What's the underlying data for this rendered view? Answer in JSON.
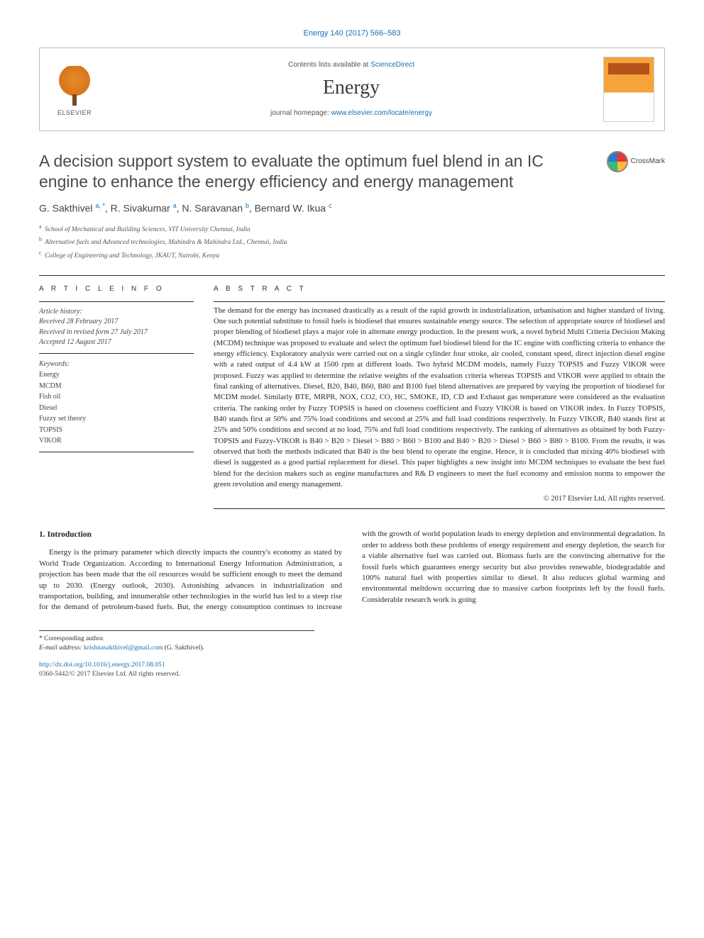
{
  "top_citation": "Energy 140 (2017) 566–583",
  "header": {
    "contents_prefix": "Contents lists available at ",
    "contents_link": "ScienceDirect",
    "journal": "Energy",
    "homepage_prefix": "journal homepage: ",
    "homepage_url": "www.elsevier.com/locate/energy",
    "publisher_word": "ELSEVIER"
  },
  "crossmark_label": "CrossMark",
  "title": "A decision support system to evaluate the optimum fuel blend in an IC engine to enhance the energy efficiency and energy management",
  "authors_html": "G. Sakthivel <sup>a, *</sup>, R. Sivakumar <sup>a</sup>, N. Saravanan <sup>b</sup>, Bernard W. Ikua <sup>c</sup>",
  "affiliations": [
    {
      "sup": "a",
      "text": "School of Mechanical and Building Sciences, VIT University Chennai, India"
    },
    {
      "sup": "b",
      "text": "Alternative fuels and Advanced technologies, Mahindra & Mahindra Ltd., Chennai, India"
    },
    {
      "sup": "c",
      "text": "College of Engineering and Technology, JKAUT, Nairobi, Kenya"
    }
  ],
  "article_info": {
    "heading": "A R T I C L E   I N F O",
    "history_label": "Article history:",
    "received": "Received 28 February 2017",
    "revised": "Received in revised form 27 July 2017",
    "accepted": "Accepted 12 August 2017",
    "keywords_label": "Keywords:",
    "keywords": [
      "Energy",
      "MCDM",
      "Fish oil",
      "Diesel",
      "Fuzzy set theory",
      "TOPSIS",
      "VIKOR"
    ]
  },
  "abstract": {
    "heading": "A B S T R A C T",
    "body": "The demand for the energy has increased drastically as a result of the rapid growth in industrialization, urbanisation and higher standard of living. One such potential substitute to fossil fuels is biodiesel that ensures sustainable energy source. The selection of appropriate source of biodiesel and proper blending of biodiesel plays a major role in alternate energy production. In the present work, a novel hybrid Multi Criteria Decision Making (MCDM) technique was proposed to evaluate and select the optimum fuel biodiesel blend for the IC engine with conflicting criteria to enhance the energy efficiency. Exploratory analysis were carried out on a single cylinder four stroke, air cooled, constant speed, direct injection diesel engine with a rated output of 4.4 kW at 1500 rpm at different loads. Two hybrid MCDM models, namely Fuzzy TOPSIS and Fuzzy VIKOR were proposed. Fuzzy was applied to determine the relative weights of the evaluation criteria whereas TOPSIS and VIKOR were applied to obtain the final ranking of alternatives. Diesel, B20, B40, B60, B80 and B100 fuel blend alternatives are prepared by varying the proportion of biodiesel for MCDM model. Similarly BTE, MRPR, NOX, CO2, CO, HC, SMOKE, ID, CD and Exhaust gas temperature were considered as the evaluation criteria. The ranking order by Fuzzy TOPSIS is based on closeness coefficient and Fuzzy VIKOR is based on VIKOR index. In Fuzzy TOPSIS, B40 stands first at 50% and 75% load conditions and second at 25% and full load conditions respectively. In Fuzzy VIKOR, B40 stands first at 25% and 50% conditions and second at no load, 75% and full load conditions respectively. The ranking of alternatives as obtained by both Fuzzy-TOPSIS and Fuzzy-VIKOR is B40 > B20 > Diesel > B80 > B60 > B100 and B40 > B20 > Diesel > B60 > B80 > B100. From the results, it was observed that both the methods indicated that B40 is the best blend to operate the engine. Hence, it is concluded that mixing 40% biodiesel with diesel is suggested as a good partial replacement for diesel. This paper highlights a new insight into MCDM techniques to evaluate the best fuel blend for the decision makers such as engine manufactures and R& D engineers to meet the fuel economy and emission norms to empower the green revolution and energy management.",
    "copyright": "© 2017 Elsevier Ltd. All rights reserved."
  },
  "intro": {
    "heading": "1. Introduction",
    "para": "Energy is the primary parameter which directly impacts the country's economy as stated by World Trade Organization. According to International Energy Information Administration, a projection has been made that the oil resources would be sufficient enough to meet the demand up to 2030. (Energy outlook, 2030). Astonishing advances in industrialization and transportation, building, and innumerable other technologies in the world has led to a steep rise for the demand of petroleum-based fuels. But, the energy consumption continues to increase with the growth of world population leads to energy depletion and environmental degradation. In order to address both these problems of energy requirement and energy depletion, the search for a viable alternative fuel was carried out. Biomass fuels are the convincing alternative for the fossil fuels which guarantees energy security but also provides renewable, biodegradable and 100% natural fuel with properties similar to diesel. It also reduces global warming and environmental meltdown occurring due to massive carbon footprints left by the fossil fuels. Considerable research work is going"
  },
  "footer": {
    "corresponding": "* Corresponding author.",
    "email_label": "E-mail address: ",
    "email": "krishnasakthivel@gmail.com",
    "email_person": " (G. Sakthivel).",
    "doi_url": "http://dx.doi.org/10.1016/j.energy.2017.08.051",
    "issn_line": "0360-5442/© 2017 Elsevier Ltd. All rights reserved."
  }
}
